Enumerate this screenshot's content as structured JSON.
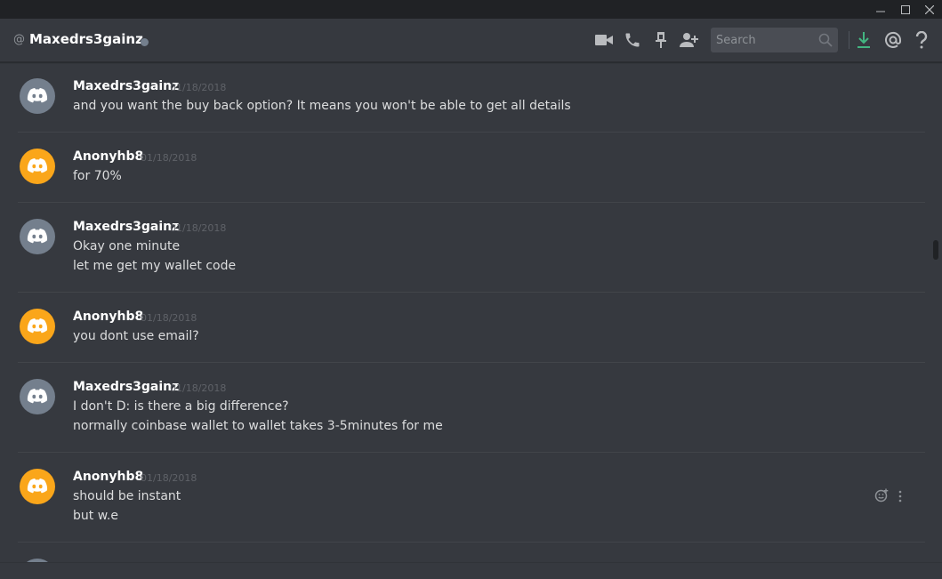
{
  "channel": {
    "at_symbol": "@",
    "name": "Maxedrs3gainz"
  },
  "header_icons": [
    "video-call-icon",
    "voice-call-icon",
    "pin-icon",
    "add-friend-icon"
  ],
  "search": {
    "placeholder": "Search"
  },
  "right_icons": [
    "download-icon",
    "mention-icon",
    "help-icon"
  ],
  "colors": {
    "bg": "#36393f",
    "gray_avatar": "#747f8d",
    "orange_avatar": "#faa61a",
    "download_green": "#43b581"
  },
  "messages": [
    {
      "author": "Maxedrs3gainz",
      "timestamp": "01/18/2018",
      "avatar": "gray",
      "lines": [
        "and you want the buy back option? It means you won't be able to get all details"
      ]
    },
    {
      "author": "Anonyhb8",
      "timestamp": "01/18/2018",
      "avatar": "orange",
      "lines": [
        "for 70%"
      ]
    },
    {
      "author": "Maxedrs3gainz",
      "timestamp": "01/18/2018",
      "avatar": "gray",
      "lines": [
        "Okay one minute",
        "let me get my wallet code"
      ]
    },
    {
      "author": "Anonyhb8",
      "timestamp": "01/18/2018",
      "avatar": "orange",
      "lines": [
        "you dont use email?"
      ]
    },
    {
      "author": "Maxedrs3gainz",
      "timestamp": "01/18/2018",
      "avatar": "gray",
      "lines": [
        "I don't D: is there a big difference?",
        "normally coinbase wallet to wallet takes 3-5minutes for me"
      ]
    },
    {
      "author": "Anonyhb8",
      "timestamp": "01/18/2018",
      "avatar": "orange",
      "lines": [
        "should be instant",
        "but w.e"
      ],
      "hovered": true
    }
  ]
}
